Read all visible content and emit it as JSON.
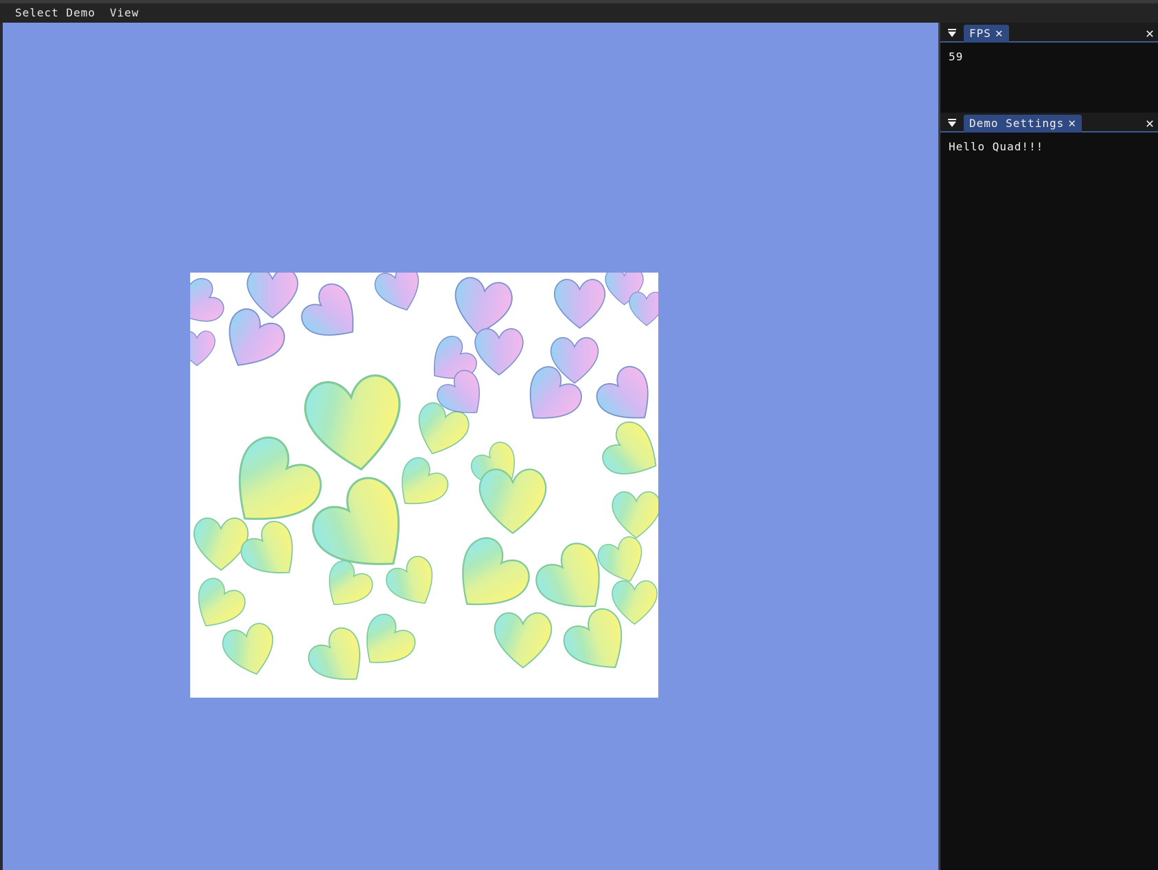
{
  "menubar": {
    "items": [
      "Select Demo",
      "View"
    ]
  },
  "viewport": {
    "background_color": "#7b95e3"
  },
  "fps_panel": {
    "tab_label": "FPS",
    "value": "59"
  },
  "settings_panel": {
    "tab_label": "Demo Settings",
    "text": "Hello Quad!!!"
  },
  "icons": {
    "collapse": "triangle-down-icon",
    "close": "close-icon"
  },
  "colors": {
    "accent_tab": "#2f4a82",
    "panel_bg": "#0f0f0f",
    "menubar_bg": "#242424"
  }
}
